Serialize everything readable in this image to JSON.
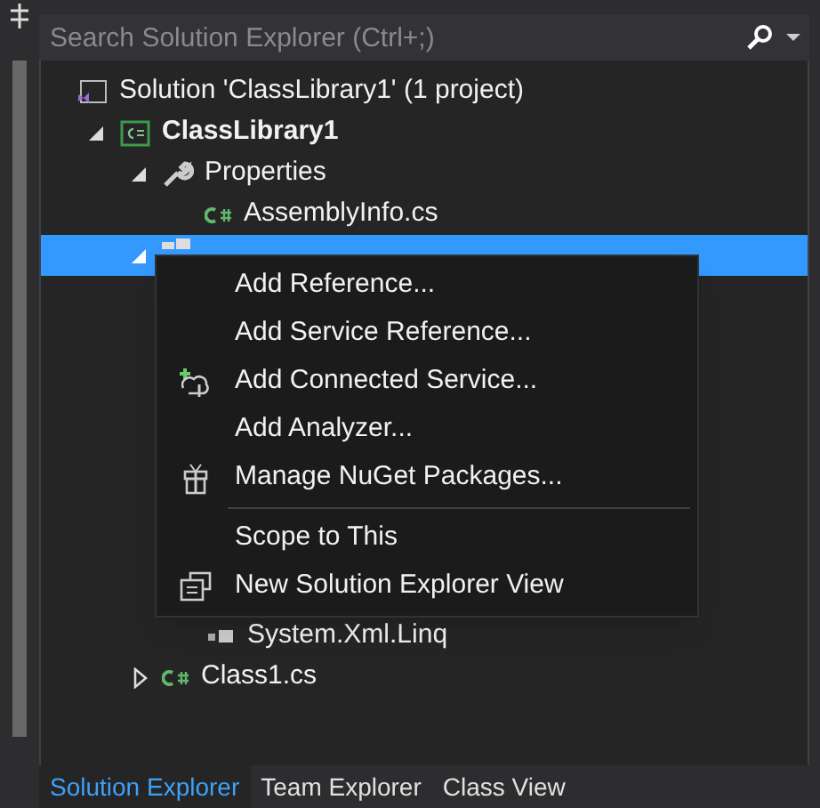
{
  "search": {
    "placeholder": "Search Solution Explorer (Ctrl+;)"
  },
  "tree": [
    {
      "label": "Solution 'ClassLibrary1' (1 project)",
      "kind": "solution",
      "selected": false,
      "children": [
        {
          "label": "ClassLibrary1",
          "kind": "project",
          "expanded": true,
          "selected": false,
          "bold": true,
          "children": [
            {
              "label": "Properties",
              "kind": "properties",
              "expanded": true,
              "selected": false,
              "children": [
                {
                  "label": "AssemblyInfo.cs",
                  "kind": "csfile",
                  "selected": false
                }
              ]
            },
            {
              "kind": "references",
              "expanded": true,
              "selected": true,
              "children": [
                {
                  "label": "System.Xml.Linq",
                  "kind": "assembly",
                  "selected": false
                }
              ]
            },
            {
              "label": "Class1.cs",
              "kind": "csfile",
              "expanded": false,
              "selected": false
            }
          ]
        }
      ]
    }
  ],
  "context_menu": [
    {
      "label": "Add Reference..."
    },
    {
      "label": "Add Service Reference..."
    },
    {
      "label": "Add Connected Service...",
      "kind": "connected"
    },
    {
      "label": "Add Analyzer..."
    },
    {
      "label": "Manage NuGet Packages...",
      "kind": "gift",
      "separator_after": true
    },
    {
      "label": "Scope to This"
    },
    {
      "label": "New Solution Explorer View",
      "kind": "windows"
    }
  ],
  "tabs": [
    {
      "label": "Solution Explorer",
      "selected": true
    },
    {
      "label": "Team Explorer",
      "selected": false
    },
    {
      "label": "Class View",
      "selected": false
    }
  ]
}
